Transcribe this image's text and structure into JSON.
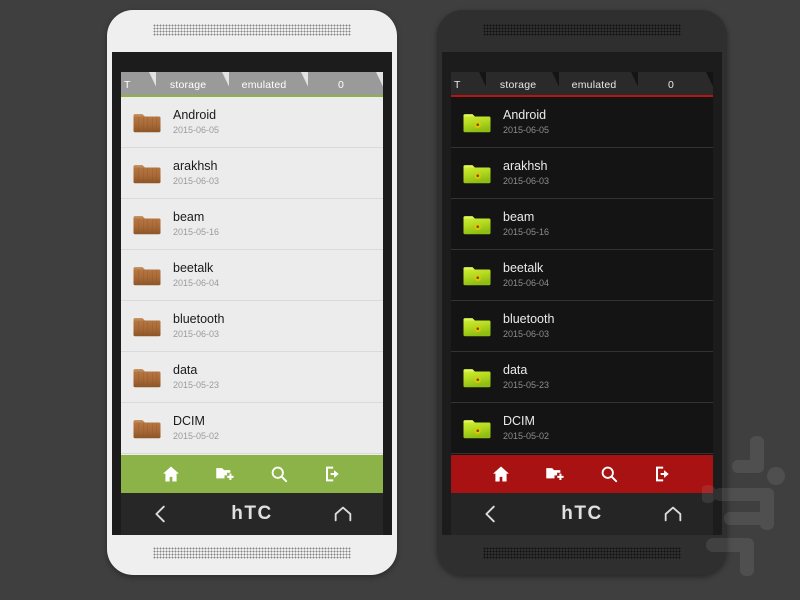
{
  "scene": {
    "background_color": "#3f3f3f",
    "watermark_name": "persian-logo-watermark"
  },
  "phones": [
    {
      "id": "light",
      "theme_name": "light-theme",
      "accent_color": "#8cb347",
      "screen_bg": "#ececec",
      "folder_icon_name": "wooden-folder-icon",
      "breadcrumb": [
        {
          "label": "T"
        },
        {
          "label": "storage"
        },
        {
          "label": "emulated"
        },
        {
          "label": "0"
        }
      ],
      "files": [
        {
          "name": "Android",
          "date": "2015-06-05"
        },
        {
          "name": "arakhsh",
          "date": "2015-06-03"
        },
        {
          "name": "beam",
          "date": "2015-05-16"
        },
        {
          "name": "beetalk",
          "date": "2015-06-04"
        },
        {
          "name": "bluetooth",
          "date": "2015-06-03"
        },
        {
          "name": "data",
          "date": "2015-05-23"
        },
        {
          "name": "DCIM",
          "date": "2015-05-02"
        }
      ],
      "toolbar": [
        {
          "icon": "home-icon",
          "label": "Home"
        },
        {
          "icon": "new-folder-icon",
          "label": "New folder"
        },
        {
          "icon": "search-icon",
          "label": "Search"
        },
        {
          "icon": "exit-icon",
          "label": "Exit"
        }
      ],
      "nav": {
        "back_icon": "back-chevron-icon",
        "brand": "hTC",
        "home_icon": "home-outline-icon"
      }
    },
    {
      "id": "dark",
      "theme_name": "dark-theme",
      "accent_color": "#a81212",
      "screen_bg": "#141414",
      "folder_icon_name": "green-folder-icon",
      "breadcrumb": [
        {
          "label": "T"
        },
        {
          "label": "storage"
        },
        {
          "label": "emulated"
        },
        {
          "label": "0"
        }
      ],
      "files": [
        {
          "name": "Android",
          "date": "2015-06-05"
        },
        {
          "name": "arakhsh",
          "date": "2015-06-03"
        },
        {
          "name": "beam",
          "date": "2015-05-16"
        },
        {
          "name": "beetalk",
          "date": "2015-06-04"
        },
        {
          "name": "bluetooth",
          "date": "2015-06-03"
        },
        {
          "name": "data",
          "date": "2015-05-23"
        },
        {
          "name": "DCIM",
          "date": "2015-05-02"
        }
      ],
      "toolbar": [
        {
          "icon": "home-icon",
          "label": "Home"
        },
        {
          "icon": "new-folder-icon",
          "label": "New folder"
        },
        {
          "icon": "search-icon",
          "label": "Search"
        },
        {
          "icon": "exit-icon",
          "label": "Exit"
        }
      ],
      "nav": {
        "back_icon": "back-chevron-icon",
        "brand": "hTC",
        "home_icon": "home-outline-icon"
      }
    }
  ]
}
